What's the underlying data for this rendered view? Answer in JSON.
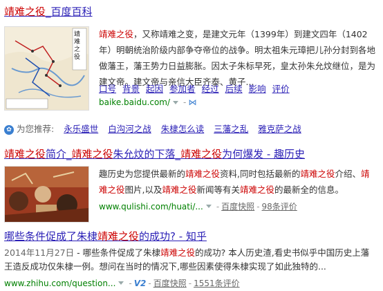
{
  "result1": {
    "title_parts": [
      "靖难之役",
      "_百度百科"
    ],
    "snippet_parts": [
      "靖难之役",
      "，又称靖难之变，是建文元年（1399年）到建文四年（1402年）明朝统治阶级内部争夺帝位的战争。明太祖朱元璋把儿孙分封到各地做藩王，藩王势力日益膨胀。因太子朱标早死，皇太孙朱允炆继位，是为建文帝。建文帝与亲信大臣齐泰、黄子..."
    ],
    "sublinks": [
      "口号",
      "背景",
      "起因",
      "参加者",
      "经过",
      "后续",
      "影响",
      "评价"
    ],
    "url": "baike.baidu.com/",
    "thumb_label": "靖难之役"
  },
  "recommend": {
    "label": "为您推荐:",
    "items": [
      "永乐盛世",
      "白沟河之战",
      "朱棣怎么读",
      "三藩之乱",
      "雅克萨之战"
    ]
  },
  "result2": {
    "title_parts": [
      "靖难之役",
      "简介_",
      "靖难之役",
      "朱允炆的下落_",
      "靖难之役",
      "为何爆发 - 趣历史"
    ],
    "snippet_parts": [
      "趣历史为您提供最新的",
      "靖难之役",
      "资料,同时包括最新的",
      "靖难之役",
      "介绍、",
      "靖难之役",
      "图片,以及",
      "靖难之役",
      "新闻等有关",
      "靖难之役",
      "的最新全的信息。"
    ],
    "url": "www.qulishi.com/huati/...",
    "cache": "百度快照",
    "reviews": "98条评价"
  },
  "result3": {
    "title_parts": [
      "哪些条件促成了朱棣",
      "靖难之役",
      "的成功? - 知乎"
    ],
    "date": "2014年11月27日",
    "snippet_parts": [
      " - 哪些条件促成了朱棣",
      "靖难之役",
      "的成功? 本人历史渣,看史书似乎中国历史上藩王造反成功仅朱棣一例。想问在当时的情况下,哪些因素使得朱棣实现了如此独特的..."
    ],
    "url": "www.zhihu.com/question...",
    "v_badge": "V2",
    "cache": "百度快照",
    "reviews": "1551条评价"
  },
  "colors": {
    "link": "#2a1fb6",
    "highlight": "#cc0000",
    "url": "#008000"
  }
}
